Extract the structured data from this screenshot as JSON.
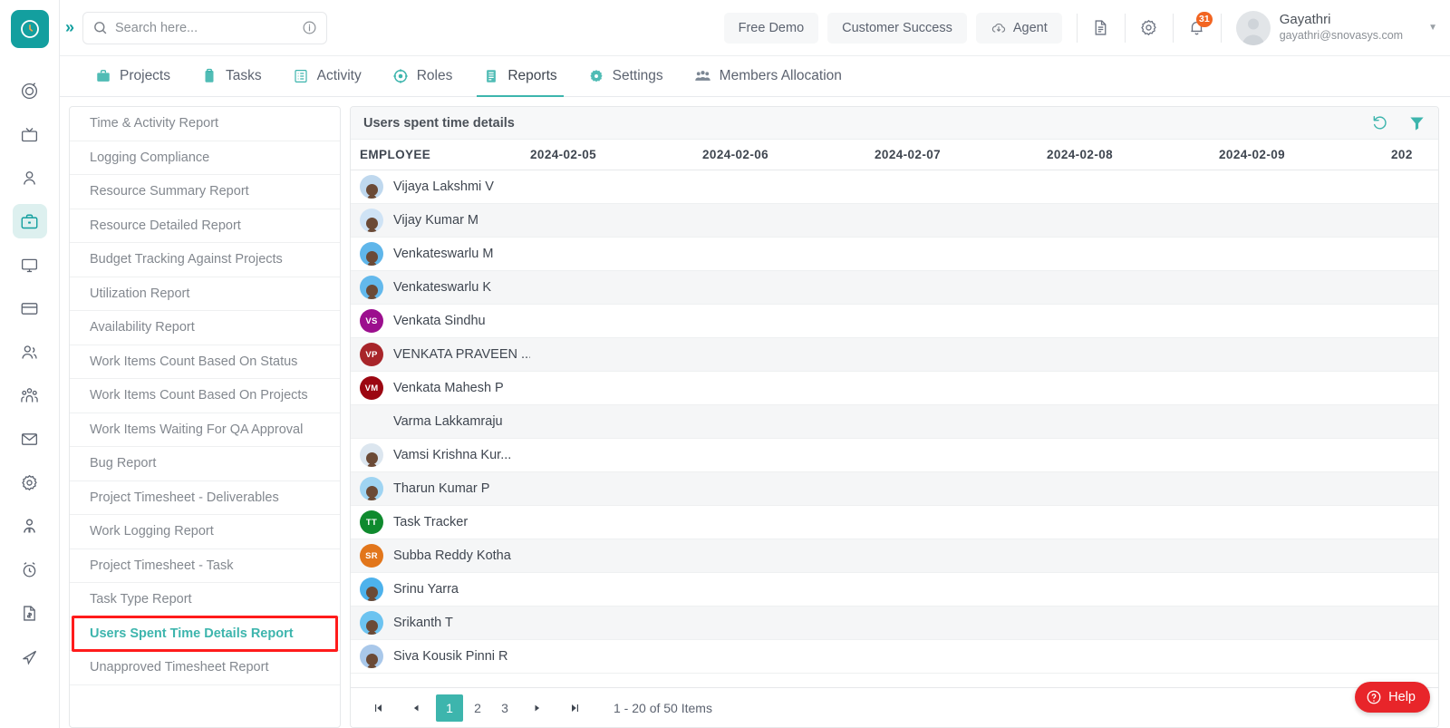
{
  "brand": {
    "logo_icon": "clock-logo-icon",
    "accent": "#139f9f",
    "tab_accent": "#3db5ad"
  },
  "header": {
    "expand_icon": "chevron-double-right-icon",
    "search": {
      "icon": "search-icon",
      "placeholder": "Search here...",
      "value": "",
      "info_icon": "info-circle-icon"
    },
    "buttons": [
      {
        "label": "Free Demo",
        "name": "free-demo-button",
        "icon": null
      },
      {
        "label": "Customer Success",
        "name": "customer-success-button",
        "icon": null
      },
      {
        "label": "Agent",
        "name": "agent-button",
        "icon": "cloud-download-icon"
      }
    ],
    "icons": [
      {
        "name": "document-icon"
      },
      {
        "name": "gear-icon"
      }
    ],
    "notification": {
      "icon": "bell-icon",
      "badge": "31",
      "badge_color": "#f26522"
    },
    "user": {
      "name": "Gayathri",
      "email": "gayathri@snovasys.com",
      "avatar_icon": "user-avatar",
      "caret_icon": "chevron-down-icon"
    }
  },
  "rail": {
    "items": [
      {
        "name": "rail-item-target",
        "icon": "target-icon",
        "active": false
      },
      {
        "name": "rail-item-tv",
        "icon": "tv-icon",
        "active": false
      },
      {
        "name": "rail-item-user",
        "icon": "user-icon",
        "active": false
      },
      {
        "name": "rail-item-briefcase",
        "icon": "briefcase-icon",
        "active": true
      },
      {
        "name": "rail-item-monitor",
        "icon": "monitor-icon",
        "active": false
      },
      {
        "name": "rail-item-card",
        "icon": "credit-card-icon",
        "active": false
      },
      {
        "name": "rail-item-users",
        "icon": "users-icon",
        "active": false
      },
      {
        "name": "rail-item-group",
        "icon": "group-icon",
        "active": false
      },
      {
        "name": "rail-item-mail",
        "icon": "mail-icon",
        "active": false
      },
      {
        "name": "rail-item-settings",
        "icon": "gear-icon",
        "active": false
      },
      {
        "name": "rail-item-employee",
        "icon": "person-tie-icon",
        "active": false
      },
      {
        "name": "rail-item-alarm",
        "icon": "alarm-clock-icon",
        "active": false
      },
      {
        "name": "rail-item-invoice",
        "icon": "invoice-icon",
        "active": false
      },
      {
        "name": "rail-item-send",
        "icon": "send-icon",
        "active": false
      }
    ]
  },
  "tabs": [
    {
      "label": "Projects",
      "icon": "briefcase-icon",
      "active": false
    },
    {
      "label": "Tasks",
      "icon": "clipboard-icon",
      "active": false
    },
    {
      "label": "Activity",
      "icon": "list-icon",
      "active": false
    },
    {
      "label": "Roles",
      "icon": "target-icon",
      "active": false
    },
    {
      "label": "Reports",
      "icon": "report-icon",
      "active": true
    },
    {
      "label": "Settings",
      "icon": "gear-icon",
      "active": false
    },
    {
      "label": "Members Allocation",
      "icon": "members-icon",
      "active": false
    }
  ],
  "report_list": {
    "items": [
      {
        "label": "Time & Activity Report",
        "selected": false
      },
      {
        "label": "Logging Compliance",
        "selected": false
      },
      {
        "label": "Resource Summary Report",
        "selected": false
      },
      {
        "label": "Resource Detailed Report",
        "selected": false
      },
      {
        "label": "Budget Tracking Against Projects",
        "selected": false
      },
      {
        "label": "Utilization Report",
        "selected": false
      },
      {
        "label": "Availability Report",
        "selected": false
      },
      {
        "label": "Work Items Count Based On Status",
        "selected": false
      },
      {
        "label": "Work Items Count Based On Projects",
        "selected": false
      },
      {
        "label": "Work Items Waiting For QA Approval",
        "selected": false
      },
      {
        "label": "Bug Report",
        "selected": false
      },
      {
        "label": "Project Timesheet - Deliverables",
        "selected": false
      },
      {
        "label": "Work Logging Report",
        "selected": false
      },
      {
        "label": "Project Timesheet - Task",
        "selected": false
      },
      {
        "label": "Task Type Report",
        "selected": false
      },
      {
        "label": "Users Spent Time Details Report",
        "selected": true
      },
      {
        "label": "Unapproved Timesheet Report",
        "selected": false
      }
    ],
    "highlight_color": "#ff1b1b"
  },
  "panel": {
    "title": "Users spent time details",
    "actions": [
      {
        "name": "reset-icon",
        "icon": "undo-icon"
      },
      {
        "name": "filter-icon",
        "icon": "funnel-icon"
      }
    ]
  },
  "table": {
    "columns": [
      "EMPLOYEE",
      "2024-02-05",
      "2024-02-06",
      "2024-02-07",
      "2024-02-08",
      "2024-02-09",
      "202"
    ],
    "rows": [
      {
        "name": "Vijaya Lakshmi V",
        "avatar_type": "photo",
        "initials": "",
        "color": "#bfd8ee",
        "values": [
          "",
          "",
          "",
          "",
          "",
          ""
        ]
      },
      {
        "name": "Vijay Kumar M",
        "avatar_type": "photo",
        "initials": "",
        "color": "#cfe3f5",
        "values": [
          "",
          "",
          "",
          "",
          "",
          ""
        ]
      },
      {
        "name": "Venkateswarlu M",
        "avatar_type": "photo",
        "initials": "",
        "color": "#5fb6ea",
        "values": [
          "",
          "",
          "",
          "",
          "",
          ""
        ]
      },
      {
        "name": "Venkateswarlu K",
        "avatar_type": "photo",
        "initials": "",
        "color": "#63b9ec",
        "values": [
          "",
          "",
          "",
          "",
          "",
          ""
        ]
      },
      {
        "name": "Venkata Sindhu",
        "avatar_type": "initials",
        "initials": "VS",
        "color": "#9c0f8e",
        "values": [
          "",
          "",
          "",
          "",
          "",
          ""
        ]
      },
      {
        "name": "VENKATA PRAVEEN ...",
        "avatar_type": "initials",
        "initials": "VP",
        "color": "#a8252a",
        "values": [
          "",
          "",
          "",
          "",
          "",
          ""
        ]
      },
      {
        "name": "Venkata Mahesh P",
        "avatar_type": "initials",
        "initials": "VM",
        "color": "#9c0712",
        "values": [
          "",
          "",
          "",
          "",
          "",
          ""
        ]
      },
      {
        "name": "Varma Lakkamraju",
        "avatar_type": "blank",
        "initials": "",
        "color": "transparent",
        "values": [
          "",
          "",
          "",
          "",
          "",
          ""
        ]
      },
      {
        "name": "Vamsi Krishna Kur...",
        "avatar_type": "photo",
        "initials": "",
        "color": "#dce6ef",
        "values": [
          "",
          "",
          "",
          "",
          "",
          ""
        ]
      },
      {
        "name": "Tharun Kumar P",
        "avatar_type": "photo",
        "initials": "",
        "color": "#9fd4f2",
        "values": [
          "",
          "",
          "",
          "",
          "",
          ""
        ]
      },
      {
        "name": "Task Tracker",
        "avatar_type": "initials",
        "initials": "TT",
        "color": "#0f8a2e",
        "values": [
          "",
          "",
          "",
          "",
          "",
          ""
        ]
      },
      {
        "name": "Subba Reddy Kotha",
        "avatar_type": "initials",
        "initials": "SR",
        "color": "#e2761b",
        "values": [
          "",
          "",
          "",
          "",
          "",
          ""
        ]
      },
      {
        "name": "Srinu Yarra",
        "avatar_type": "photo",
        "initials": "",
        "color": "#4db2ec",
        "values": [
          "",
          "",
          "",
          "",
          "",
          ""
        ]
      },
      {
        "name": "Srikanth T",
        "avatar_type": "photo",
        "initials": "",
        "color": "#6cc3f0",
        "values": [
          "",
          "",
          "",
          "",
          "",
          ""
        ]
      },
      {
        "name": "Siva Kousik Pinni R",
        "avatar_type": "photo",
        "initials": "",
        "color": "#a9c8ea",
        "values": [
          "",
          "",
          "",
          "",
          "",
          ""
        ]
      }
    ]
  },
  "pagination": {
    "first_label": "⏮",
    "prev_label": "◀",
    "pages": [
      "1",
      "2",
      "3"
    ],
    "current_page": "1",
    "next_label": "▶",
    "last_label": "⏭",
    "info": "1 - 20 of 50 Items"
  },
  "help": {
    "label": "Help",
    "icon": "question-circle-icon",
    "color": "#e8252a"
  }
}
